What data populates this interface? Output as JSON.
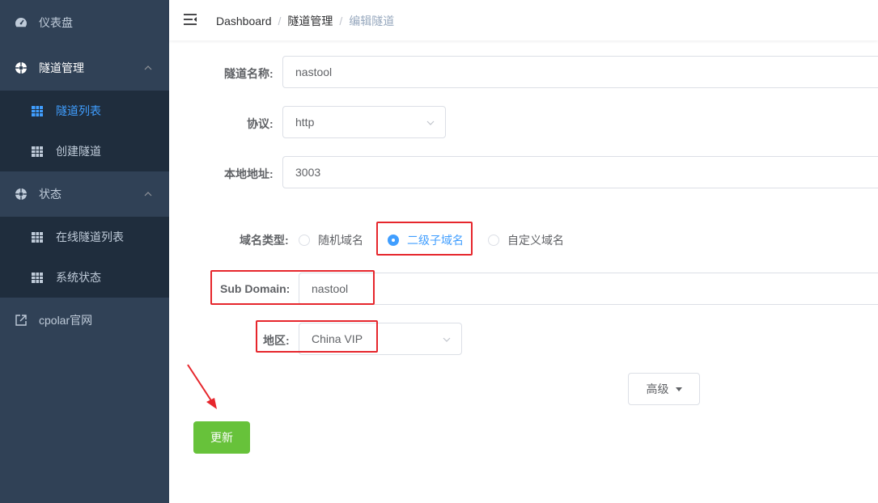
{
  "sidebar": {
    "items": [
      {
        "label": "仪表盘",
        "icon": "dashboard-icon"
      },
      {
        "label": "隧道管理",
        "icon": "tunnel-icon"
      },
      {
        "label": "隧道列表",
        "icon": "grid-icon"
      },
      {
        "label": "创建隧道",
        "icon": "grid-icon"
      },
      {
        "label": "状态",
        "icon": "status-icon"
      },
      {
        "label": "在线隧道列表",
        "icon": "grid-icon"
      },
      {
        "label": "系统状态",
        "icon": "grid-icon"
      },
      {
        "label": "cpolar官网",
        "icon": "external-link-icon"
      }
    ]
  },
  "breadcrumb": [
    "Dashboard",
    "隧道管理",
    "编辑隧道"
  ],
  "form": {
    "name_label": "隧道名称:",
    "name_value": "nastool",
    "protocol_label": "协议:",
    "protocol_value": "http",
    "local_label": "本地地址:",
    "local_value": "3003",
    "domain_type_label": "域名类型:",
    "domain_types": [
      "随机域名",
      "二级子域名",
      "自定义域名"
    ],
    "domain_type_selected": "二级子域名",
    "subdomain_label": "Sub Domain:",
    "subdomain_value": "nastool",
    "region_label": "地区:",
    "region_value": "China VIP",
    "advanced_label": "高级",
    "update_label": "更新"
  },
  "colors": {
    "sidebar": "#304156",
    "submenu": "#1f2d3d",
    "accent": "#409eff",
    "success": "#67c23a",
    "highlight": "#e6262c"
  }
}
